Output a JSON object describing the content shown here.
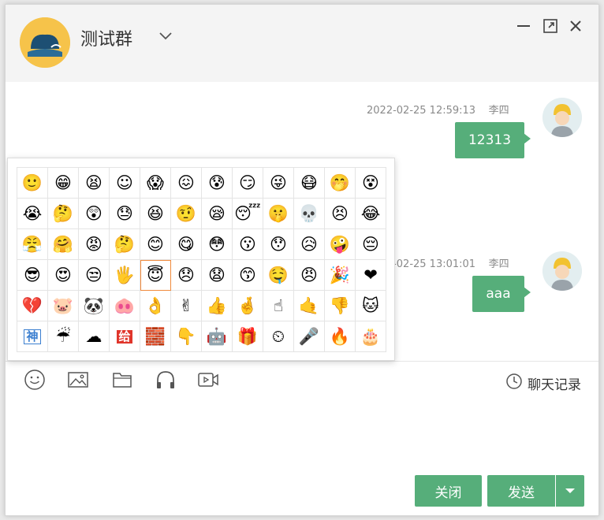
{
  "header": {
    "group_name": "测试群"
  },
  "messages": [
    {
      "time": "2022-02-25 12:59:13",
      "sender": "李四",
      "text": "12313"
    },
    {
      "time": "2022-02-25 13:01:01",
      "sender": "李四",
      "text": "aaa"
    }
  ],
  "emoji_panel": {
    "rows": [
      [
        "🙂",
        "😁",
        "😫",
        "☺",
        "😱",
        "😖",
        "😰",
        "😏",
        "😜",
        "😷",
        "🤭",
        "😵"
      ],
      [
        "😭",
        "🤔",
        "😲",
        "😓",
        "😆",
        "🤨",
        "😪",
        "😴",
        "🤫",
        "💀",
        "😣",
        "😂"
      ],
      [
        "😤",
        "🤗",
        "😡",
        "🤔",
        "😊",
        "😋",
        "😳",
        "😗",
        "😯",
        "😥",
        "🤪",
        "😔"
      ],
      [
        "😎",
        "😍",
        "😒",
        "🖐",
        "😇",
        "😞",
        "😧",
        "😙",
        "🤤",
        "😠",
        "🎉",
        "❤"
      ],
      [
        "💔",
        "🐷",
        "🐼",
        "🐽",
        "👌",
        "✌",
        "👍",
        "🤞",
        "☝",
        "🤙",
        "👎",
        "🐱"
      ],
      [
        "神",
        "☔",
        "☁",
        "给",
        "🧱",
        "👇",
        "🤖",
        "🎁",
        "⏲",
        "🎤",
        "🔥",
        "🎂"
      ]
    ],
    "hovered_index": 40
  },
  "toolbar": {
    "history_label": "聊天记录"
  },
  "input": {
    "value": ""
  },
  "buttons": {
    "close_label": "关闭",
    "send_label": "发送"
  },
  "colors": {
    "accent": "#56ae7a",
    "group_avatar_bg": "#f6c34a"
  }
}
